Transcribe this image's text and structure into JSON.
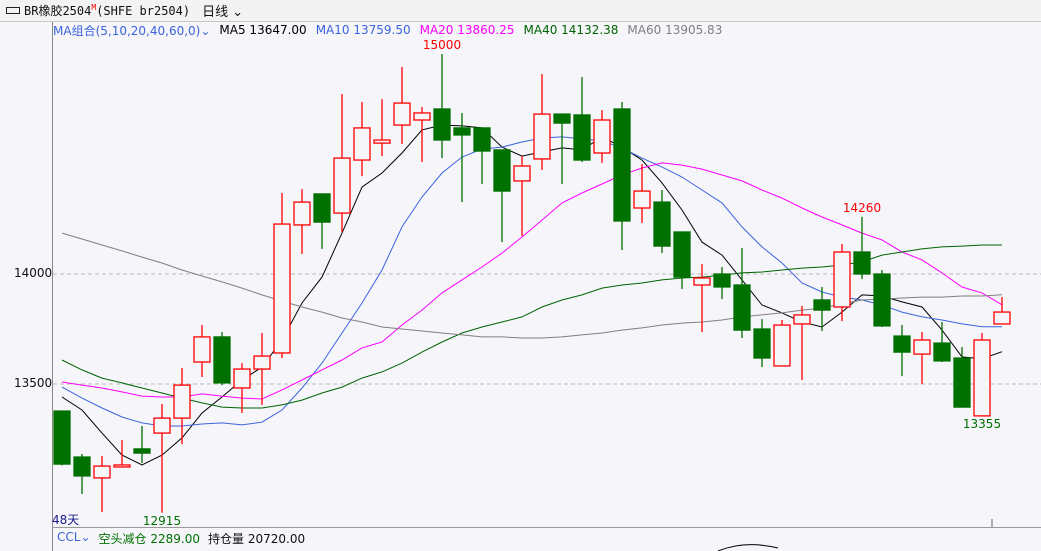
{
  "header": {
    "title": "BR橡胶2504",
    "title_badge": "M",
    "exchange": "(SHFE br2504)",
    "period": "日线",
    "period_icon": "chevron-down-icon"
  },
  "legend": {
    "combo": "MA组合(5,10,20,40,60,0)",
    "items": [
      {
        "label": "MA5 13647.00",
        "color": "#000000"
      },
      {
        "label": "MA10 13759.50",
        "color": "#3c64dc"
      },
      {
        "label": "MA20 13860.25",
        "color": "#ff00ff"
      },
      {
        "label": "MA40 14132.38",
        "color": "#006400"
      },
      {
        "label": "MA60 13905.83",
        "color": "#808080"
      }
    ]
  },
  "days_label": "48天",
  "bottom": {
    "indicator": "CCL",
    "status": "空头减仓",
    "status_value": "2289.00",
    "oi_label": "持仓量",
    "oi_value": "20720.00"
  },
  "colors": {
    "up": "#ff0000",
    "down": "#007000"
  },
  "chart_data": {
    "type": "candlestick",
    "y_ticks": [
      {
        "value": 14000,
        "label": "14000"
      },
      {
        "value": 13500,
        "label": "13500"
      }
    ],
    "annotations": [
      {
        "index": 19,
        "value": 15000,
        "label": "15000",
        "pos": "above",
        "color": "#ff0000"
      },
      {
        "index": 40,
        "value": 14260,
        "label": "14260",
        "pos": "above",
        "color": "#ff0000"
      },
      {
        "index": 46,
        "value": 13355,
        "label": "13355",
        "pos": "below",
        "color": "#007000"
      },
      {
        "index": 5,
        "value": 12915,
        "label": "12915",
        "pos": "below",
        "color": "#007000"
      }
    ],
    "ohlc": [
      [
        13377,
        13380,
        13130,
        13136
      ],
      [
        13168,
        13182,
        13000,
        13082
      ],
      [
        13073,
        13173,
        12918,
        13127
      ],
      [
        13123,
        13245,
        13120,
        13132
      ],
      [
        13205,
        13309,
        13141,
        13186
      ],
      [
        13277,
        13409,
        12915,
        13345
      ],
      [
        13345,
        13573,
        13227,
        13495
      ],
      [
        13600,
        13768,
        13532,
        13714
      ],
      [
        13714,
        13736,
        13495,
        13505
      ],
      [
        13482,
        13595,
        13368,
        13568
      ],
      [
        13568,
        13732,
        13405,
        13627
      ],
      [
        13641,
        14368,
        13618,
        14227
      ],
      [
        14223,
        14386,
        14091,
        14327
      ],
      [
        14364,
        14364,
        14114,
        14236
      ],
      [
        14277,
        14818,
        14191,
        14527
      ],
      [
        14518,
        14782,
        14445,
        14664
      ],
      [
        14595,
        14795,
        14536,
        14609
      ],
      [
        14677,
        14941,
        14591,
        14777
      ],
      [
        14700,
        14759,
        14509,
        14732
      ],
      [
        14750,
        15000,
        14527,
        14609
      ],
      [
        14664,
        14732,
        14327,
        14632
      ],
      [
        14664,
        14664,
        14409,
        14559
      ],
      [
        14564,
        14564,
        14145,
        14377
      ],
      [
        14423,
        14536,
        14173,
        14491
      ],
      [
        14523,
        14909,
        14473,
        14727
      ],
      [
        14727,
        14727,
        14409,
        14686
      ],
      [
        14723,
        14895,
        14509,
        14518
      ],
      [
        14550,
        14745,
        14505,
        14700
      ],
      [
        14750,
        14782,
        14109,
        14241
      ],
      [
        14300,
        14500,
        14232,
        14377
      ],
      [
        14327,
        14382,
        14095,
        14127
      ],
      [
        14191,
        14191,
        13932,
        13986
      ],
      [
        13950,
        14045,
        13736,
        13982
      ],
      [
        14000,
        14032,
        13886,
        13941
      ],
      [
        13950,
        14118,
        13709,
        13745
      ],
      [
        13750,
        13795,
        13577,
        13618
      ],
      [
        13582,
        13791,
        13582,
        13768
      ],
      [
        13773,
        13855,
        13518,
        13814
      ],
      [
        13882,
        13941,
        13741,
        13836
      ],
      [
        13850,
        14136,
        13786,
        14100
      ],
      [
        14100,
        14260,
        13977,
        14000
      ],
      [
        14000,
        14018,
        13759,
        13764
      ],
      [
        13718,
        13768,
        13536,
        13645
      ],
      [
        13636,
        13736,
        13500,
        13700
      ],
      [
        13686,
        13782,
        13600,
        13605
      ],
      [
        13618,
        13668,
        13395,
        13395
      ],
      [
        13355,
        13732,
        13355,
        13700
      ],
      [
        13773,
        13895,
        13773,
        13827
      ]
    ],
    "ma": [
      {
        "name": "MA5",
        "color": "#000000",
        "values": [
          13441,
          13382,
          13277,
          13177,
          13132,
          13177,
          13255,
          13368,
          13441,
          13518,
          13577,
          13700,
          13868,
          13986,
          14186,
          14395,
          14459,
          14550,
          14655,
          14677,
          14673,
          14664,
          14577,
          14536,
          14555,
          14573,
          14564,
          14623,
          14577,
          14518,
          14414,
          14291,
          14145,
          14086,
          13973,
          13859,
          13823,
          13782,
          13759,
          13827,
          13905,
          13900,
          13873,
          13850,
          13745,
          13623,
          13614,
          13647
        ]
      },
      {
        "name": "MA10",
        "color": "#3c64dc",
        "values": [
          13486,
          13436,
          13391,
          13350,
          13323,
          13309,
          13309,
          13318,
          13323,
          13314,
          13327,
          13382,
          13482,
          13595,
          13732,
          13868,
          14018,
          14214,
          14350,
          14459,
          14532,
          14568,
          14577,
          14600,
          14618,
          14623,
          14614,
          14605,
          14573,
          14527,
          14486,
          14441,
          14382,
          14323,
          14214,
          14123,
          14050,
          13959,
          13918,
          13895,
          13882,
          13859,
          13827,
          13805,
          13791,
          13773,
          13760,
          13760
        ]
      },
      {
        "name": "MA20",
        "color": "#ff00ff",
        "values": [
          13509,
          13495,
          13482,
          13464,
          13445,
          13441,
          13441,
          13455,
          13445,
          13436,
          13432,
          13473,
          13518,
          13564,
          13609,
          13664,
          13691,
          13768,
          13836,
          13914,
          13973,
          14032,
          14095,
          14168,
          14245,
          14323,
          14368,
          14409,
          14450,
          14482,
          14505,
          14495,
          14477,
          14450,
          14423,
          14382,
          14345,
          14300,
          14259,
          14223,
          14186,
          14155,
          14100,
          14064,
          14005,
          13941,
          13914,
          13860
        ]
      },
      {
        "name": "MA40",
        "color": "#006400",
        "values": [
          13609,
          13564,
          13527,
          13505,
          13482,
          13459,
          13436,
          13414,
          13395,
          13391,
          13391,
          13405,
          13427,
          13459,
          13486,
          13527,
          13555,
          13595,
          13645,
          13691,
          13732,
          13759,
          13782,
          13805,
          13850,
          13882,
          13905,
          13936,
          13950,
          13959,
          13973,
          13982,
          13986,
          13995,
          14005,
          14009,
          14018,
          14027,
          14032,
          14041,
          14055,
          14086,
          14100,
          14114,
          14123,
          14127,
          14132,
          14132
        ]
      },
      {
        "name": "MA60",
        "color": "#808080",
        "values": [
          14186,
          14159,
          14132,
          14105,
          14077,
          14050,
          14018,
          13991,
          13964,
          13936,
          13905,
          13877,
          13850,
          13827,
          13800,
          13782,
          13759,
          13750,
          13741,
          13732,
          13723,
          13714,
          13714,
          13709,
          13709,
          13714,
          13723,
          13732,
          13745,
          13755,
          13768,
          13777,
          13782,
          13791,
          13805,
          13814,
          13823,
          13836,
          13845,
          13864,
          13882,
          13886,
          13891,
          13895,
          13895,
          13900,
          13900,
          13906
        ]
      }
    ]
  }
}
